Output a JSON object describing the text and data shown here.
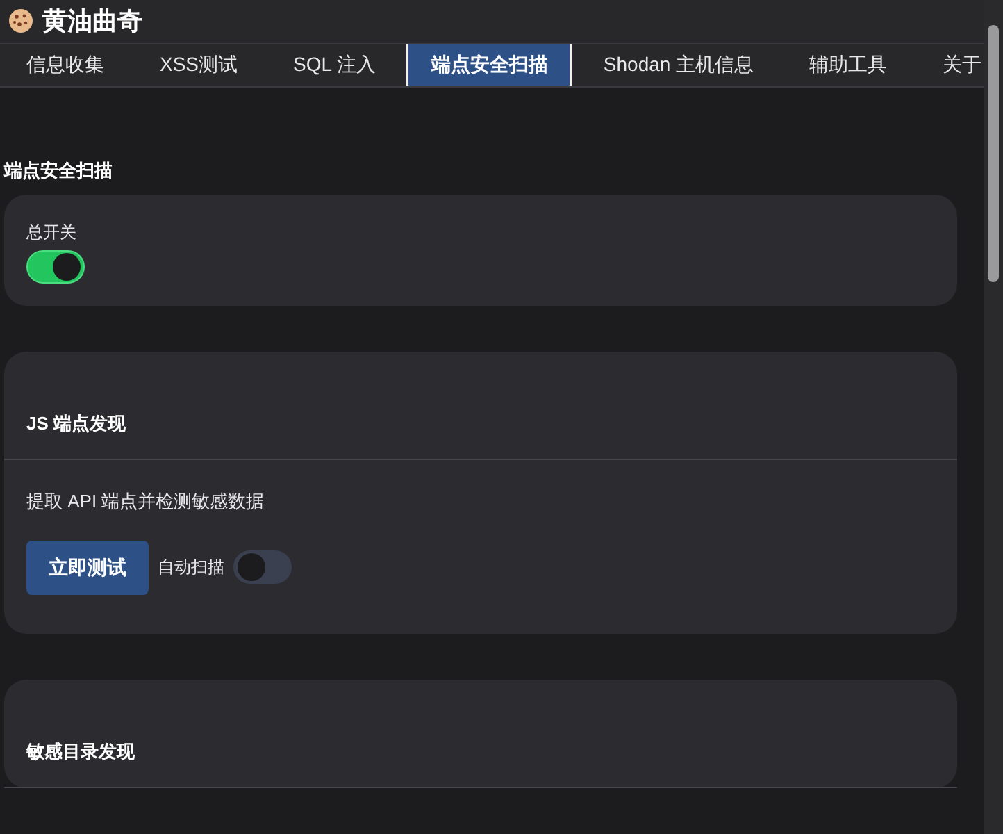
{
  "app": {
    "title": "黄油曲奇"
  },
  "tabs": [
    {
      "label": "信息收集",
      "selected": false
    },
    {
      "label": "XSS测试",
      "selected": false
    },
    {
      "label": "SQL 注入",
      "selected": false
    },
    {
      "label": "端点安全扫描",
      "selected": true
    },
    {
      "label": "Shodan 主机信息",
      "selected": false
    },
    {
      "label": "辅助工具",
      "selected": false
    },
    {
      "label": "关于",
      "selected": false
    }
  ],
  "section_title": "端点安全扫描",
  "master_switch": {
    "label": "总开关",
    "on": true
  },
  "modules": [
    {
      "title": "JS 端点发现",
      "description": "提取 API 端点并检测敏感数据",
      "button": "立即测试",
      "auto_scan": {
        "label": "自动扫描",
        "on": false
      }
    },
    {
      "title": "敏感目录发现"
    }
  ]
}
